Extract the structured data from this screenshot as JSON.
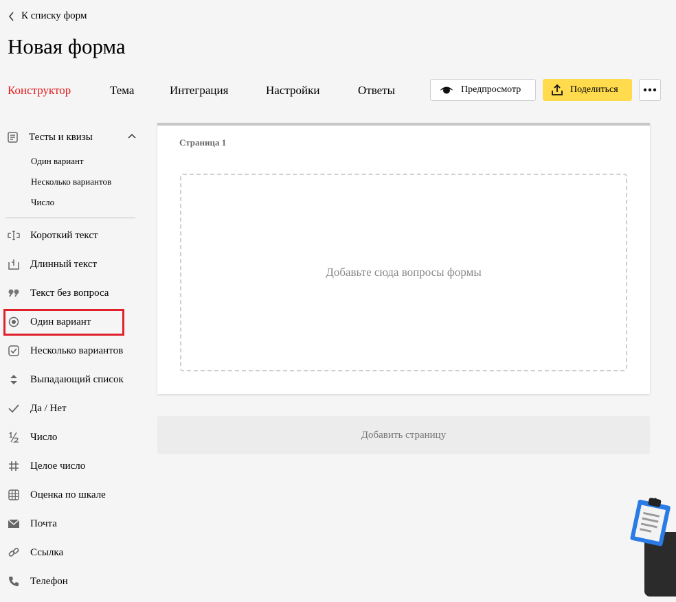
{
  "nav": {
    "back_label": "К списку форм"
  },
  "page": {
    "title": "Новая форма"
  },
  "tabs": [
    {
      "label": "Конструктор",
      "active": true
    },
    {
      "label": "Тема"
    },
    {
      "label": "Интеграция"
    },
    {
      "label": "Настройки"
    },
    {
      "label": "Ответы"
    }
  ],
  "toolbar": {
    "preview_label": "Предпросмотр",
    "share_label": "Поделиться",
    "accent_color": "#ffdb4d"
  },
  "sidebar": {
    "group": {
      "label": "Тесты и квизы",
      "expanded": true,
      "items": [
        "Один вариант",
        "Несколько вариантов",
        "Число"
      ]
    },
    "items": [
      {
        "label": "Короткий текст",
        "icon": "short-text-icon"
      },
      {
        "label": "Длинный текст",
        "icon": "long-text-icon"
      },
      {
        "label": "Текст без вопроса",
        "icon": "quote-icon"
      },
      {
        "label": "Один вариант",
        "icon": "radio-icon",
        "highlighted": true
      },
      {
        "label": "Несколько вариантов",
        "icon": "checkbox-icon"
      },
      {
        "label": "Выпадающий список",
        "icon": "dropdown-icon"
      },
      {
        "label": "Да / Нет",
        "icon": "check-icon"
      },
      {
        "label": "Число",
        "icon": "fraction-icon"
      },
      {
        "label": "Целое число",
        "icon": "hash-icon"
      },
      {
        "label": "Оценка по шкале",
        "icon": "grid-icon"
      },
      {
        "label": "Почта",
        "icon": "mail-icon"
      },
      {
        "label": "Ссылка",
        "icon": "link-icon"
      },
      {
        "label": "Телефон",
        "icon": "phone-icon"
      }
    ]
  },
  "editor": {
    "page_label": "Страница 1",
    "dropzone_text": "Добавьте сюда вопросы формы",
    "add_page_label": "Добавить страницу"
  }
}
